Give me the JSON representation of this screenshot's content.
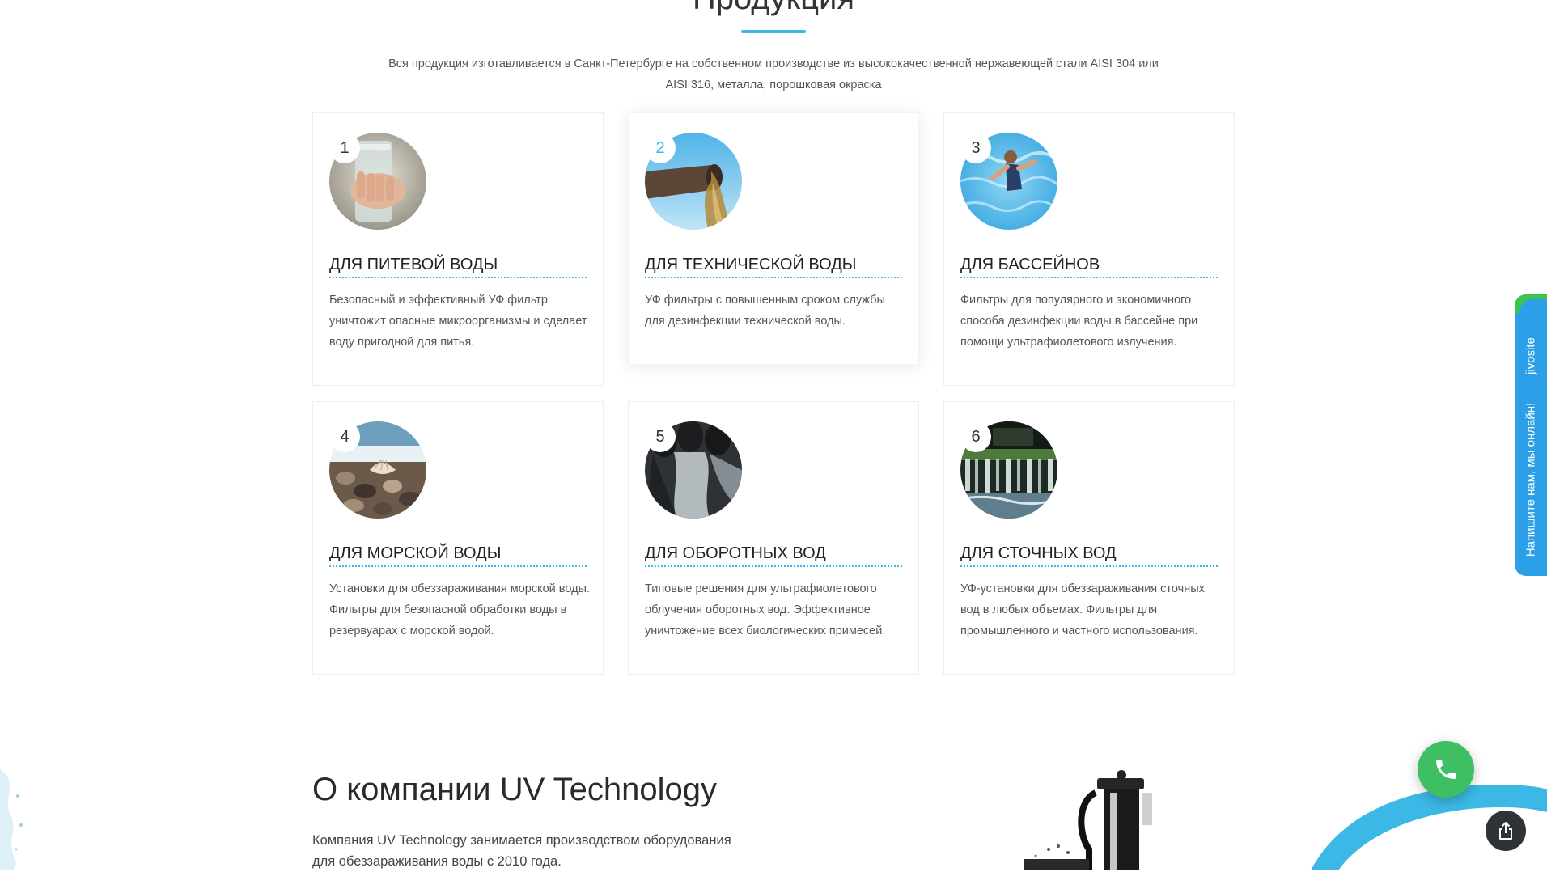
{
  "products_section": {
    "title": "Продукция",
    "subtitle_line1": "Вся продукция изготавливается в Санкт-Петербурге на собственном производстве из высококачественной нержавеющей стали AISI 304 или",
    "subtitle_line2": "AISI 316, металла, порошковая окраска",
    "accent_color": "#3bb8e6",
    "cards": [
      {
        "number": "1",
        "title": "ДЛЯ ПИТЕВОЙ ВОДЫ",
        "text": "Безопасный и эффективный УФ фильтр уничтожит опасные микроорганизмы и сделает воду пригодной для питья.",
        "image": "glass-of-water-photo"
      },
      {
        "number": "2",
        "title": "ДЛЯ ТЕХНИЧЕСКОЙ ВОДЫ",
        "text": "УФ фильтры с повышенным сроком службы для дезинфекции технической воды.",
        "image": "pipe-outflow-photo"
      },
      {
        "number": "3",
        "title": "ДЛЯ БАССЕЙНОВ",
        "text": "Фильтры для популярного и экономичного способа дезинфекции воды в бассейне при помощи ультрафиолетового излучения.",
        "image": "swimming-pool-photo"
      },
      {
        "number": "4",
        "title": "ДЛЯ МОРСКОЙ ВОДЫ",
        "text": "Установки для обеззараживания морской воды. Фильтры для безопасной обработки воды в резервуарах с морской водой.",
        "image": "sea-shore-pebbles-photo"
      },
      {
        "number": "5",
        "title": "ДЛЯ ОБОРОТНЫХ ВОД",
        "text": "Типовые решения для ультрафиолетового облучения оборотных вод. Эффективное уничтожение всех биологических примесей.",
        "image": "industrial-pipes-photo"
      },
      {
        "number": "6",
        "title": "ДЛЯ СТОЧНЫХ ВОД",
        "text": "УФ-установки для обеззараживания сточных вод в любых объемах. Фильтры для промышленного и частного использования.",
        "image": "wastewater-cascade-photo"
      }
    ]
  },
  "about_section": {
    "title": "О компании UV Technology",
    "text_line1": "Компания UV Technology занимается производством оборудования",
    "text_line2": "для обеззараживания воды с 2010 года."
  },
  "chat_widget": {
    "brand": "jivosite",
    "label": "Напишите нам, мы онлайн!",
    "tab_color": "#2ba0e8",
    "corner_color": "#3cc44f"
  },
  "call_button": {
    "icon": "phone-icon",
    "color": "#3fbf63"
  },
  "share_button": {
    "icon": "share-icon",
    "color": "#2f3338"
  }
}
